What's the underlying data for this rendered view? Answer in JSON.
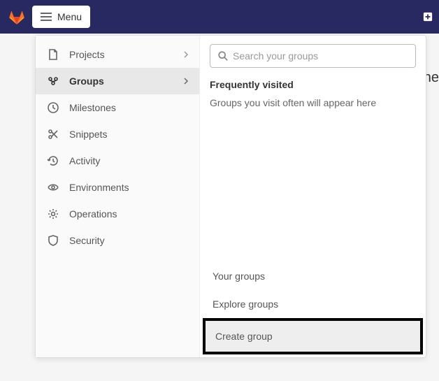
{
  "topbar": {
    "menu_label": "Menu"
  },
  "nav": {
    "projects": "Projects",
    "groups": "Groups",
    "milestones": "Milestones",
    "snippets": "Snippets",
    "activity": "Activity",
    "environments": "Environments",
    "operations": "Operations",
    "security": "Security"
  },
  "search": {
    "placeholder": "Search your groups"
  },
  "content": {
    "freq_title": "Frequently visited",
    "freq_sub": "Groups you visit often will appear here"
  },
  "footer": {
    "your_groups": "Your groups",
    "explore_groups": "Explore groups",
    "create_group": "Create group"
  },
  "bg_fragment": "ne"
}
